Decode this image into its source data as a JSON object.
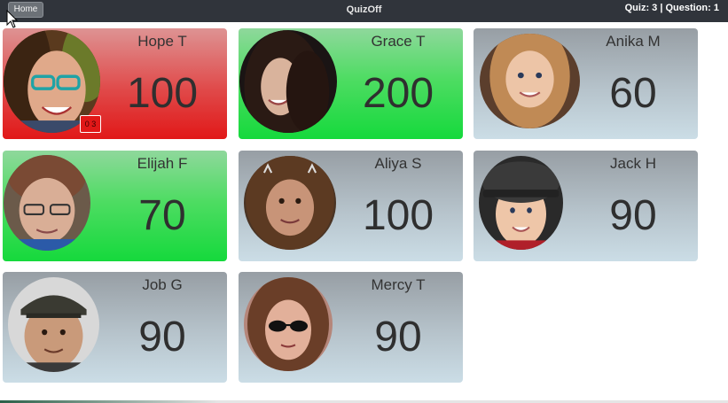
{
  "topbar": {
    "home_label": "Home",
    "app_title": "QuizOff",
    "status": "Quiz: 3 | Question: 1"
  },
  "colors": {
    "gray_card": "#b6c3cb",
    "green_card": "#15d93c",
    "red_card": "#e11818",
    "topbar": "#30343b"
  },
  "players": [
    {
      "name": "Hope T",
      "score": "100",
      "state": "red",
      "badge": "0 3"
    },
    {
      "name": "Grace T",
      "score": "200",
      "state": "green"
    },
    {
      "name": "Anika M",
      "score": "60",
      "state": "gray"
    },
    {
      "name": "Elijah F",
      "score": "70",
      "state": "green"
    },
    {
      "name": "Aliya S",
      "score": "100",
      "state": "gray"
    },
    {
      "name": "Jack H",
      "score": "90",
      "state": "gray"
    },
    {
      "name": "Job G",
      "score": "90",
      "state": "gray"
    },
    {
      "name": "Mercy T",
      "score": "90",
      "state": "gray"
    }
  ]
}
